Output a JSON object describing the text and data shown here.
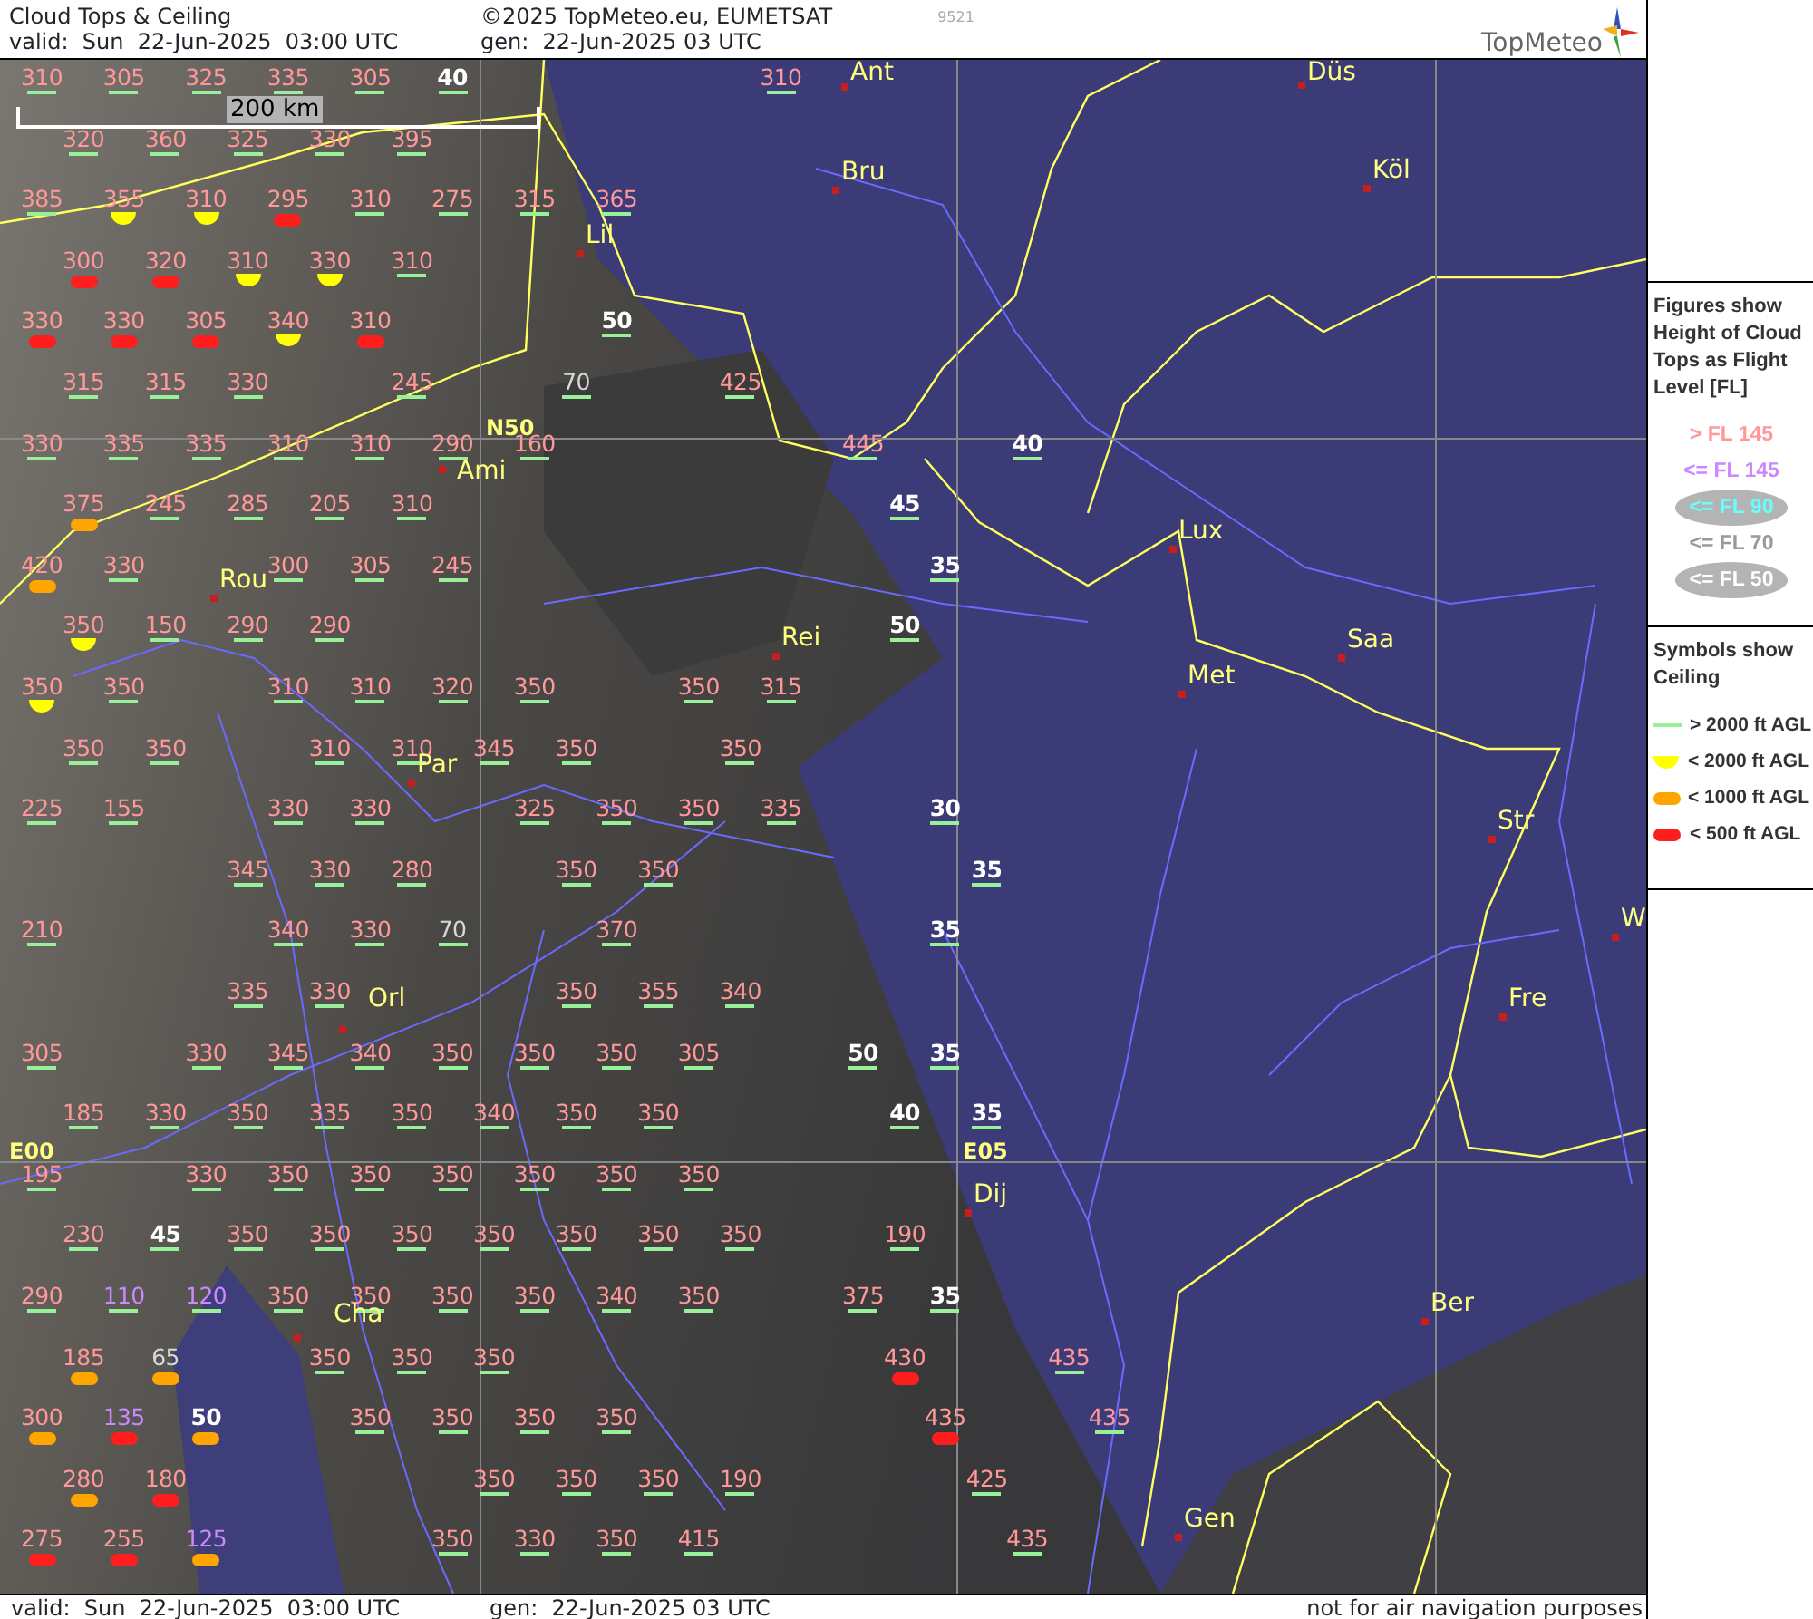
{
  "header": {
    "title": "Cloud Tops & Ceiling",
    "copyright": "©2025 TopMeteo.eu, EUMETSAT",
    "code": "9521",
    "valid": "valid:  Sun  22-Jun-2025  03:00 UTC",
    "generated": "gen:  22-Jun-2025 03 UTC",
    "logo": "TopMeteo"
  },
  "map": {
    "scale_label": "200 km",
    "grid_labels": [
      "N50",
      "E00",
      "E05"
    ],
    "cities": [
      "Ant",
      "Düs",
      "Bru",
      "Köl",
      "Lil",
      "Ami",
      "Lux",
      "Rou",
      "Rei",
      "Saa",
      "Met",
      "Par",
      "Str",
      "W",
      "Fre",
      "Orl",
      "Dij",
      "Ber",
      "Cha",
      "Gen"
    ],
    "rows": [
      [
        {
          "fl": "310",
          "color": "#ff9898",
          "kind": "high"
        },
        {
          "fl": "305",
          "color": "#ff9898",
          "kind": "high"
        },
        {
          "fl": "325",
          "color": "#ff9898",
          "kind": "high"
        },
        {
          "fl": "335",
          "color": "#ff9898",
          "kind": "high"
        },
        {
          "fl": "305",
          "color": "#ff9898",
          "kind": "high"
        },
        {
          "fl": "40",
          "color": "#ffffff",
          "kind": "high"
        },
        null,
        null,
        null,
        {
          "fl": "310",
          "color": "#ff9898",
          "kind": "high"
        }
      ],
      [
        {
          "fl": "320",
          "color": "#ff9898",
          "kind": "high"
        },
        {
          "fl": "360",
          "color": "#ff9898",
          "kind": "high"
        },
        {
          "fl": "325",
          "color": "#ff9898",
          "kind": "high"
        },
        {
          "fl": "330",
          "color": "#ff9898",
          "kind": "high"
        },
        {
          "fl": "395",
          "color": "#ff9898",
          "kind": "high"
        }
      ],
      [
        {
          "fl": "385",
          "color": "#ff9898",
          "kind": "high"
        },
        {
          "fl": "355",
          "color": "#ff9898",
          "kind": "lt2000"
        },
        {
          "fl": "310",
          "color": "#ff9898",
          "kind": "lt2000"
        },
        {
          "fl": "295",
          "color": "#ff9898",
          "kind": "lt500"
        },
        {
          "fl": "310",
          "color": "#ff9898",
          "kind": "high"
        },
        {
          "fl": "275",
          "color": "#ff9898",
          "kind": "high"
        },
        {
          "fl": "315",
          "color": "#ff9898",
          "kind": "high"
        },
        {
          "fl": "365",
          "color": "#ff9898",
          "kind": "high"
        }
      ],
      [
        {
          "fl": "300",
          "color": "#ff9898",
          "kind": "lt500"
        },
        {
          "fl": "320",
          "color": "#ff9898",
          "kind": "lt500"
        },
        {
          "fl": "310",
          "color": "#ff9898",
          "kind": "lt2000"
        },
        {
          "fl": "330",
          "color": "#ff9898",
          "kind": "lt2000"
        },
        {
          "fl": "310",
          "color": "#ff9898",
          "kind": "high"
        }
      ],
      [
        {
          "fl": "330",
          "color": "#ff9898",
          "kind": "lt500"
        },
        {
          "fl": "330",
          "color": "#ff9898",
          "kind": "lt500"
        },
        {
          "fl": "305",
          "color": "#ff9898",
          "kind": "lt500"
        },
        {
          "fl": "340",
          "color": "#ff9898",
          "kind": "lt2000"
        },
        {
          "fl": "310",
          "color": "#ff9898",
          "kind": "lt500"
        },
        null,
        null,
        {
          "fl": "50",
          "color": "#ffffff",
          "kind": "high"
        }
      ],
      [
        {
          "fl": "315",
          "color": "#ff9898",
          "kind": "high"
        },
        {
          "fl": "315",
          "color": "#ff9898",
          "kind": "high"
        },
        {
          "fl": "330",
          "color": "#ff9898",
          "kind": "high"
        },
        null,
        {
          "fl": "245",
          "color": "#ff9898",
          "kind": "high"
        },
        null,
        {
          "fl": "70",
          "color": "#d8d8d8",
          "kind": "high"
        },
        null,
        {
          "fl": "425",
          "color": "#ff9898",
          "kind": "high"
        }
      ],
      [
        {
          "fl": "330",
          "color": "#ff9898",
          "kind": "high"
        },
        {
          "fl": "335",
          "color": "#ff9898",
          "kind": "high"
        },
        {
          "fl": "335",
          "color": "#ff9898",
          "kind": "high"
        },
        {
          "fl": "310",
          "color": "#ff9898",
          "kind": "high"
        },
        {
          "fl": "310",
          "color": "#ff9898",
          "kind": "high"
        },
        {
          "fl": "290",
          "color": "#ff9898",
          "kind": "high"
        },
        {
          "fl": "160",
          "color": "#ff9898",
          "kind": "high"
        },
        null,
        null,
        null,
        {
          "fl": "445",
          "color": "#ff9898",
          "kind": "high"
        },
        null,
        {
          "fl": "40",
          "color": "#ffffff",
          "kind": "high"
        }
      ],
      [
        {
          "fl": "375",
          "color": "#ff9898",
          "kind": "lt1000"
        },
        {
          "fl": "245",
          "color": "#ff9898",
          "kind": "high"
        },
        {
          "fl": "285",
          "color": "#ff9898",
          "kind": "high"
        },
        {
          "fl": "205",
          "color": "#ff9898",
          "kind": "high"
        },
        {
          "fl": "310",
          "color": "#ff9898",
          "kind": "high"
        },
        null,
        null,
        null,
        null,
        null,
        {
          "fl": "45",
          "color": "#ffffff",
          "kind": "high"
        }
      ],
      [
        {
          "fl": "420",
          "color": "#ff9898",
          "kind": "lt1000"
        },
        {
          "fl": "330",
          "color": "#ff9898",
          "kind": "high"
        },
        null,
        {
          "fl": "300",
          "color": "#ff9898",
          "kind": "high"
        },
        {
          "fl": "305",
          "color": "#ff9898",
          "kind": "high"
        },
        {
          "fl": "245",
          "color": "#ff9898",
          "kind": "high"
        },
        null,
        null,
        null,
        null,
        null,
        {
          "fl": "35",
          "color": "#ffffff",
          "kind": "high"
        }
      ],
      [
        {
          "fl": "350",
          "color": "#ff9898",
          "kind": "lt2000"
        },
        {
          "fl": "150",
          "color": "#ff9898",
          "kind": "high"
        },
        {
          "fl": "290",
          "color": "#ff9898",
          "kind": "high"
        },
        {
          "fl": "290",
          "color": "#ff9898",
          "kind": "high"
        },
        null,
        null,
        null,
        null,
        null,
        null,
        {
          "fl": "50",
          "color": "#ffffff",
          "kind": "high"
        }
      ],
      [
        {
          "fl": "350",
          "color": "#ff9898",
          "kind": "lt2000"
        },
        {
          "fl": "350",
          "color": "#ff9898",
          "kind": "high"
        },
        null,
        {
          "fl": "310",
          "color": "#ff9898",
          "kind": "high"
        },
        {
          "fl": "310",
          "color": "#ff9898",
          "kind": "high"
        },
        {
          "fl": "320",
          "color": "#ff9898",
          "kind": "high"
        },
        {
          "fl": "350",
          "color": "#ff9898",
          "kind": "high"
        },
        null,
        {
          "fl": "350",
          "color": "#ff9898",
          "kind": "high"
        },
        {
          "fl": "315",
          "color": "#ff9898",
          "kind": "high"
        }
      ],
      [
        {
          "fl": "350",
          "color": "#ff9898",
          "kind": "high"
        },
        {
          "fl": "350",
          "color": "#ff9898",
          "kind": "high"
        },
        null,
        {
          "fl": "310",
          "color": "#ff9898",
          "kind": "high"
        },
        {
          "fl": "310",
          "color": "#ff9898",
          "kind": "high"
        },
        {
          "fl": "345",
          "color": "#ff9898",
          "kind": "high"
        },
        {
          "fl": "350",
          "color": "#ff9898",
          "kind": "high"
        },
        null,
        {
          "fl": "350",
          "color": "#ff9898",
          "kind": "high"
        }
      ],
      [
        {
          "fl": "225",
          "color": "#ff9898",
          "kind": "high"
        },
        {
          "fl": "155",
          "color": "#ff9898",
          "kind": "high"
        },
        null,
        {
          "fl": "330",
          "color": "#ff9898",
          "kind": "high"
        },
        {
          "fl": "330",
          "color": "#ff9898",
          "kind": "high"
        },
        null,
        {
          "fl": "325",
          "color": "#ff9898",
          "kind": "high"
        },
        {
          "fl": "350",
          "color": "#ff9898",
          "kind": "high"
        },
        {
          "fl": "350",
          "color": "#ff9898",
          "kind": "high"
        },
        {
          "fl": "335",
          "color": "#ff9898",
          "kind": "high"
        },
        null,
        {
          "fl": "30",
          "color": "#ffffff",
          "kind": "high"
        }
      ],
      [
        null,
        null,
        {
          "fl": "345",
          "color": "#ff9898",
          "kind": "high"
        },
        {
          "fl": "330",
          "color": "#ff9898",
          "kind": "high"
        },
        {
          "fl": "280",
          "color": "#ff9898",
          "kind": "high"
        },
        null,
        {
          "fl": "350",
          "color": "#ff9898",
          "kind": "high"
        },
        {
          "fl": "350",
          "color": "#ff9898",
          "kind": "high"
        },
        null,
        null,
        null,
        {
          "fl": "35",
          "color": "#ffffff",
          "kind": "high"
        }
      ],
      [
        {
          "fl": "210",
          "color": "#ff9898",
          "kind": "high"
        },
        null,
        null,
        {
          "fl": "340",
          "color": "#ff9898",
          "kind": "high"
        },
        {
          "fl": "330",
          "color": "#ff9898",
          "kind": "high"
        },
        {
          "fl": "70",
          "color": "#d8d8d8",
          "kind": "high"
        },
        null,
        {
          "fl": "370",
          "color": "#ff9898",
          "kind": "high"
        },
        null,
        null,
        null,
        {
          "fl": "35",
          "color": "#ffffff",
          "kind": "high"
        }
      ],
      [
        null,
        null,
        {
          "fl": "335",
          "color": "#ff9898",
          "kind": "high"
        },
        {
          "fl": "330",
          "color": "#ff9898",
          "kind": "high"
        },
        null,
        null,
        {
          "fl": "350",
          "color": "#ff9898",
          "kind": "high"
        },
        {
          "fl": "355",
          "color": "#ff9898",
          "kind": "high"
        },
        {
          "fl": "340",
          "color": "#ff9898",
          "kind": "high"
        }
      ],
      [
        {
          "fl": "305",
          "color": "#ff9898",
          "kind": "high"
        },
        null,
        {
          "fl": "330",
          "color": "#ff9898",
          "kind": "high"
        },
        {
          "fl": "345",
          "color": "#ff9898",
          "kind": "high"
        },
        {
          "fl": "340",
          "color": "#ff9898",
          "kind": "high"
        },
        {
          "fl": "350",
          "color": "#ff9898",
          "kind": "high"
        },
        {
          "fl": "350",
          "color": "#ff9898",
          "kind": "high"
        },
        {
          "fl": "350",
          "color": "#ff9898",
          "kind": "high"
        },
        {
          "fl": "305",
          "color": "#ff9898",
          "kind": "high"
        },
        null,
        {
          "fl": "50",
          "color": "#ffffff",
          "kind": "high"
        },
        {
          "fl": "35",
          "color": "#ffffff",
          "kind": "high"
        }
      ],
      [
        {
          "fl": "185",
          "color": "#ff9898",
          "kind": "high"
        },
        {
          "fl": "330",
          "color": "#ff9898",
          "kind": "high"
        },
        {
          "fl": "350",
          "color": "#ff9898",
          "kind": "high"
        },
        {
          "fl": "335",
          "color": "#ff9898",
          "kind": "high"
        },
        {
          "fl": "350",
          "color": "#ff9898",
          "kind": "high"
        },
        {
          "fl": "340",
          "color": "#ff9898",
          "kind": "high"
        },
        {
          "fl": "350",
          "color": "#ff9898",
          "kind": "high"
        },
        {
          "fl": "350",
          "color": "#ff9898",
          "kind": "high"
        },
        null,
        null,
        {
          "fl": "40",
          "color": "#ffffff",
          "kind": "high"
        },
        {
          "fl": "35",
          "color": "#ffffff",
          "kind": "high"
        }
      ],
      [
        {
          "fl": "195",
          "color": "#ff9898",
          "kind": "high"
        },
        null,
        {
          "fl": "330",
          "color": "#ff9898",
          "kind": "high"
        },
        {
          "fl": "350",
          "color": "#ff9898",
          "kind": "high"
        },
        {
          "fl": "350",
          "color": "#ff9898",
          "kind": "high"
        },
        {
          "fl": "350",
          "color": "#ff9898",
          "kind": "high"
        },
        {
          "fl": "350",
          "color": "#ff9898",
          "kind": "high"
        },
        {
          "fl": "350",
          "color": "#ff9898",
          "kind": "high"
        },
        {
          "fl": "350",
          "color": "#ff9898",
          "kind": "high"
        }
      ],
      [
        {
          "fl": "230",
          "color": "#ff9898",
          "kind": "high"
        },
        {
          "fl": "45",
          "color": "#ffffff",
          "kind": "high"
        },
        {
          "fl": "350",
          "color": "#ff9898",
          "kind": "high"
        },
        {
          "fl": "350",
          "color": "#ff9898",
          "kind": "high"
        },
        {
          "fl": "350",
          "color": "#ff9898",
          "kind": "high"
        },
        {
          "fl": "350",
          "color": "#ff9898",
          "kind": "high"
        },
        {
          "fl": "350",
          "color": "#ff9898",
          "kind": "high"
        },
        {
          "fl": "350",
          "color": "#ff9898",
          "kind": "high"
        },
        {
          "fl": "350",
          "color": "#ff9898",
          "kind": "high"
        },
        null,
        {
          "fl": "190",
          "color": "#ff9898",
          "kind": "high"
        }
      ],
      [
        {
          "fl": "290",
          "color": "#ff9898",
          "kind": "high"
        },
        {
          "fl": "110",
          "color": "#cc88ff",
          "kind": "high"
        },
        {
          "fl": "120",
          "color": "#cc88ff",
          "kind": "high"
        },
        {
          "fl": "350",
          "color": "#ff9898",
          "kind": "high"
        },
        {
          "fl": "350",
          "color": "#ff9898",
          "kind": "high"
        },
        {
          "fl": "350",
          "color": "#ff9898",
          "kind": "high"
        },
        {
          "fl": "350",
          "color": "#ff9898",
          "kind": "high"
        },
        {
          "fl": "340",
          "color": "#ff9898",
          "kind": "high"
        },
        {
          "fl": "350",
          "color": "#ff9898",
          "kind": "high"
        },
        null,
        {
          "fl": "375",
          "color": "#ff9898",
          "kind": "high"
        },
        {
          "fl": "35",
          "color": "#ffffff",
          "kind": "high"
        }
      ],
      [
        {
          "fl": "185",
          "color": "#ff9898",
          "kind": "lt1000"
        },
        {
          "fl": "65",
          "color": "#d8d8d8",
          "kind": "lt1000"
        },
        null,
        {
          "fl": "350",
          "color": "#ff9898",
          "kind": "high"
        },
        {
          "fl": "350",
          "color": "#ff9898",
          "kind": "high"
        },
        {
          "fl": "350",
          "color": "#ff9898",
          "kind": "high"
        },
        null,
        null,
        null,
        null,
        {
          "fl": "430",
          "color": "#ff9898",
          "kind": "lt500"
        },
        null,
        {
          "fl": "435",
          "color": "#ff9898",
          "kind": "high"
        }
      ],
      [
        {
          "fl": "300",
          "color": "#ff9898",
          "kind": "lt1000"
        },
        {
          "fl": "135",
          "color": "#cc88ff",
          "kind": "lt500"
        },
        {
          "fl": "50",
          "color": "#ffffff",
          "kind": "lt1000"
        },
        null,
        {
          "fl": "350",
          "color": "#ff9898",
          "kind": "high"
        },
        {
          "fl": "350",
          "color": "#ff9898",
          "kind": "high"
        },
        {
          "fl": "350",
          "color": "#ff9898",
          "kind": "high"
        },
        {
          "fl": "350",
          "color": "#ff9898",
          "kind": "high"
        },
        null,
        null,
        null,
        {
          "fl": "435",
          "color": "#ff9898",
          "kind": "lt500"
        },
        null,
        {
          "fl": "435",
          "color": "#ff9898",
          "kind": "high"
        }
      ],
      [
        {
          "fl": "280",
          "color": "#ff9898",
          "kind": "lt1000"
        },
        {
          "fl": "180",
          "color": "#ff9898",
          "kind": "lt500"
        },
        null,
        null,
        null,
        {
          "fl": "350",
          "color": "#ff9898",
          "kind": "high"
        },
        {
          "fl": "350",
          "color": "#ff9898",
          "kind": "high"
        },
        {
          "fl": "350",
          "color": "#ff9898",
          "kind": "high"
        },
        {
          "fl": "190",
          "color": "#ff9898",
          "kind": "high"
        },
        null,
        null,
        {
          "fl": "425",
          "color": "#ff9898",
          "kind": "high"
        }
      ],
      [
        {
          "fl": "275",
          "color": "#ff9898",
          "kind": "lt500"
        },
        {
          "fl": "255",
          "color": "#ff9898",
          "kind": "lt500"
        },
        {
          "fl": "125",
          "color": "#cc88ff",
          "kind": "lt1000"
        },
        null,
        null,
        {
          "fl": "350",
          "color": "#ff9898",
          "kind": "high"
        },
        {
          "fl": "330",
          "color": "#ff9898",
          "kind": "high"
        },
        {
          "fl": "350",
          "color": "#ff9898",
          "kind": "high"
        },
        {
          "fl": "415",
          "color": "#ff9898",
          "kind": "high"
        },
        null,
        null,
        null,
        {
          "fl": "435",
          "color": "#ff9898",
          "kind": "high"
        }
      ]
    ]
  },
  "legend": {
    "figures_title": "Figures show Height of Cloud Tops as Flight Level  [FL]",
    "figures": [
      {
        "label": "> FL 145",
        "color": "#ff9898",
        "kind": "plain"
      },
      {
        "label": "<= FL 145",
        "color": "#cc88ff",
        "kind": "plain"
      },
      {
        "label": "<= FL 90",
        "color": "#66ffff",
        "kind": "oval"
      },
      {
        "label": "<= FL 70",
        "color": "#9a9a9a",
        "kind": "plain"
      },
      {
        "label": "<= FL 50",
        "color": "#ffffff",
        "kind": "oval"
      }
    ],
    "symbols_title": "Symbols show Ceiling",
    "symbols": [
      {
        "label": "> 2000 ft AGL",
        "kind": "high"
      },
      {
        "label": "< 2000 ft AGL",
        "kind": "lt2000"
      },
      {
        "label": "< 1000 ft AGL",
        "kind": "lt1000"
      },
      {
        "label": "< 500 ft AGL",
        "kind": "lt500"
      }
    ]
  },
  "footer": {
    "valid": "valid:  Sun  22-Jun-2025  03:00 UTC",
    "generated": "gen:  22-Jun-2025 03 UTC",
    "note": "not for air navigation purposes"
  }
}
